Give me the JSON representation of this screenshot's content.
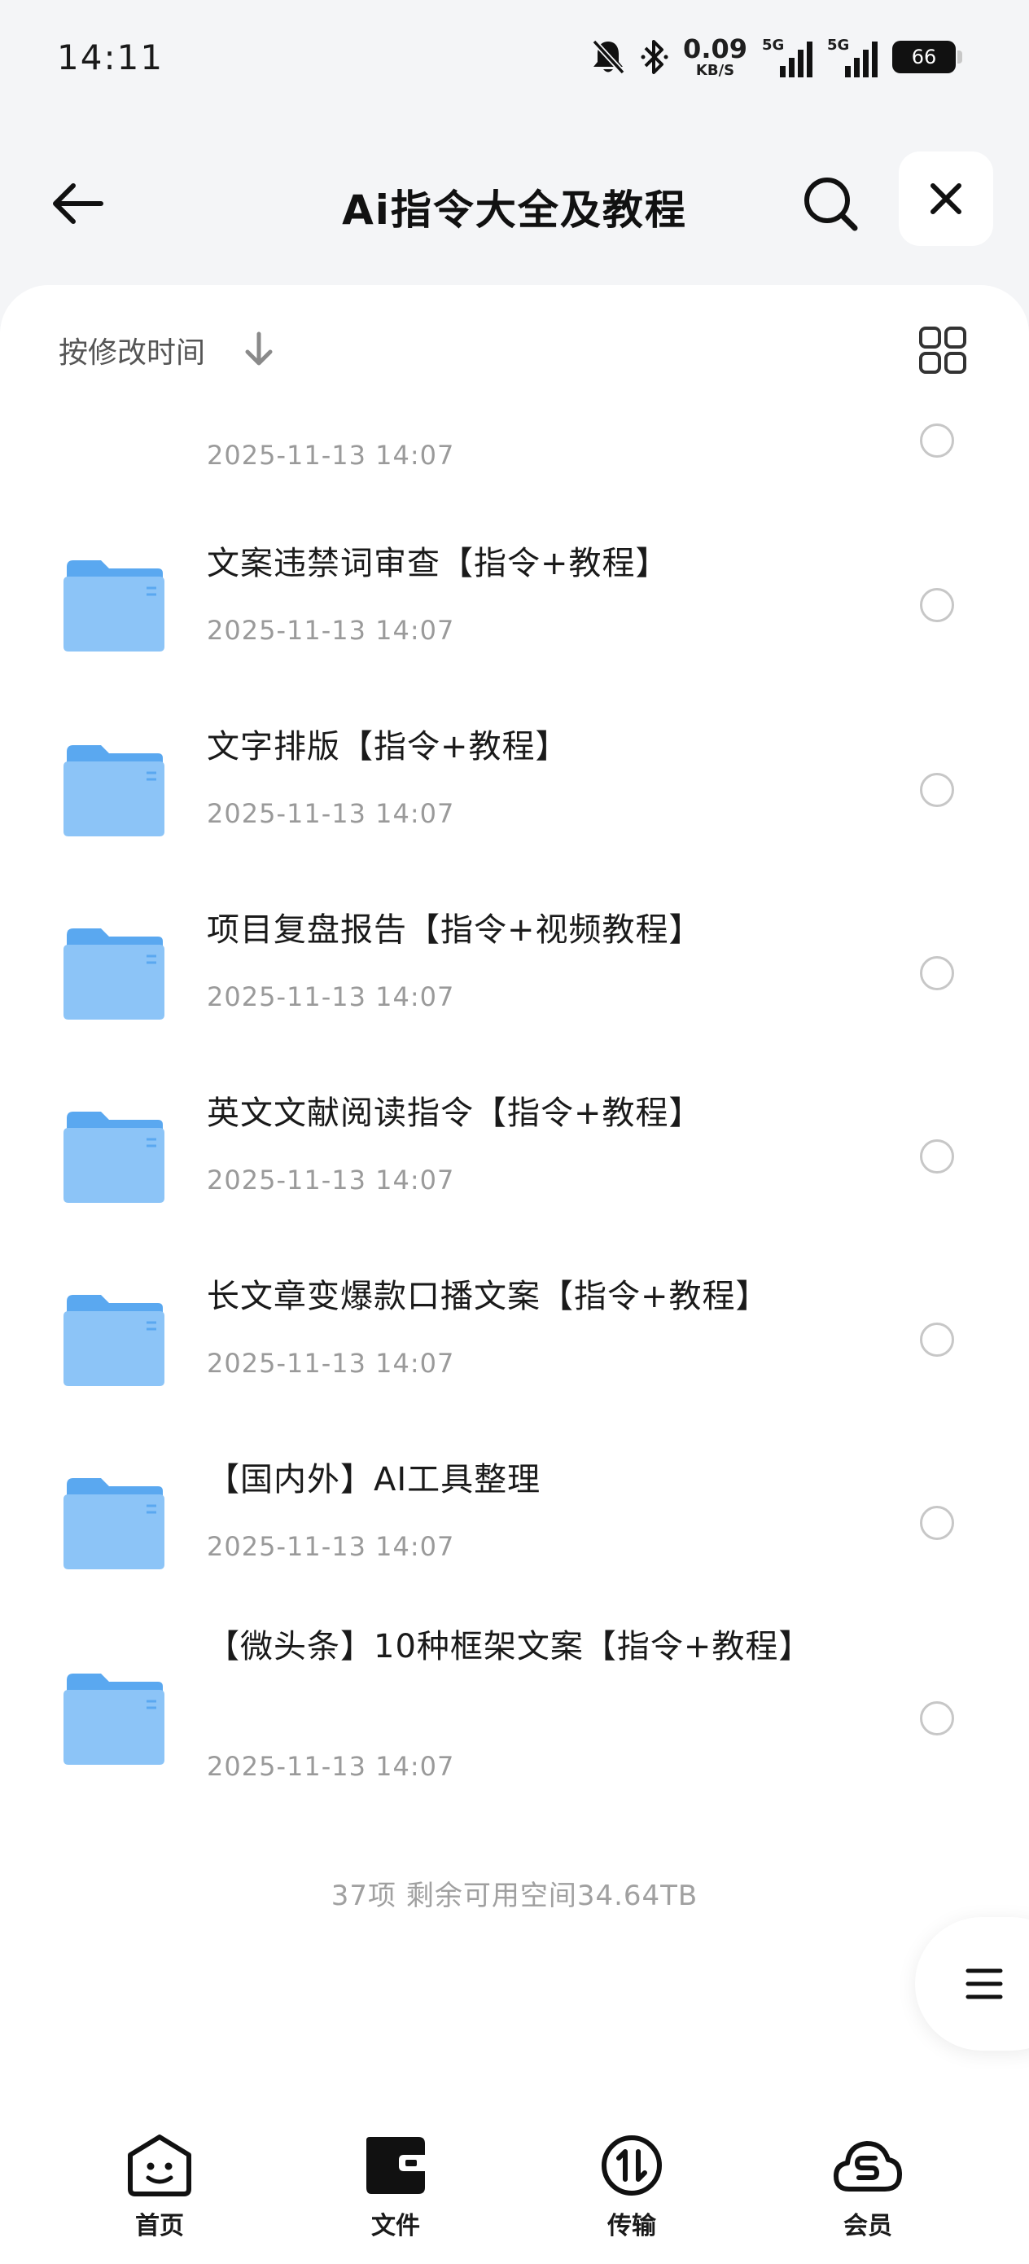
{
  "status_bar": {
    "time": "14:11",
    "net_speed_value": "0.09",
    "net_speed_unit": "KB/S",
    "sim1_label": "5G",
    "sim2_label": "5G",
    "battery": "66"
  },
  "header": {
    "title": "Ai指令大全及教程"
  },
  "sort_bar": {
    "label": "按修改时间"
  },
  "files": [
    {
      "name": "",
      "date": "2025-11-13 14:07"
    },
    {
      "name": "文案违禁词审查【指令+教程】",
      "date": "2025-11-13 14:07"
    },
    {
      "name": "文字排版【指令+教程】",
      "date": "2025-11-13 14:07"
    },
    {
      "name": "项目复盘报告【指令+视频教程】",
      "date": "2025-11-13 14:07"
    },
    {
      "name": "英文文献阅读指令【指令+教程】",
      "date": "2025-11-13 14:07"
    },
    {
      "name": "长文章变爆款口播文案【指令+教程】",
      "date": "2025-11-13 14:07"
    },
    {
      "name": "【国内外】AI工具整理",
      "date": "2025-11-13 14:07"
    },
    {
      "name": "【微头条】10种框架文案【指令+教程】",
      "date": "2025-11-13 14:07"
    }
  ],
  "footer": {
    "summary": "37项 剩余可用空间34.64TB"
  },
  "bottom_nav": {
    "items": [
      {
        "label": "首页",
        "icon": "home-face-icon"
      },
      {
        "label": "文件",
        "icon": "folder-icon"
      },
      {
        "label": "传输",
        "icon": "transfer-icon"
      },
      {
        "label": "会员",
        "icon": "member-cloud-icon"
      }
    ]
  },
  "colors": {
    "folder_back": "#5aa8f0",
    "folder_front": "#8cc4f7",
    "background": "#f4f5f7"
  }
}
